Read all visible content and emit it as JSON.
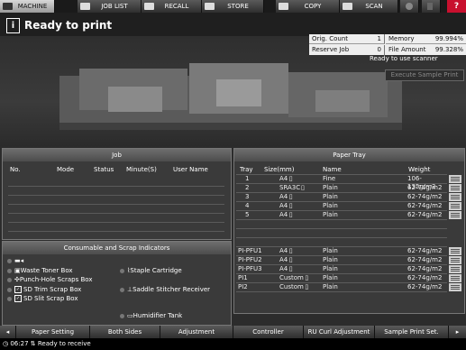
{
  "tabs": [
    {
      "label": "MACHINE",
      "active": true,
      "icon": "machine-icon"
    },
    {
      "label": "JOB LIST",
      "active": false,
      "icon": "job-list-icon"
    },
    {
      "label": "RECALL",
      "active": false,
      "icon": "recall-icon"
    },
    {
      "label": "STORE",
      "active": false,
      "icon": "store-icon"
    },
    {
      "label": "COPY",
      "active": false,
      "icon": "copy-icon"
    },
    {
      "label": "SCAN",
      "active": false,
      "icon": "scan-icon"
    }
  ],
  "help_label": "?",
  "status": {
    "icon": "i",
    "title": "Ready to print"
  },
  "counters": {
    "orig_count_label": "Orig. Count",
    "orig_count_value": "1",
    "memory_label": "Memory",
    "memory_value": "99.994%",
    "reserve_job_label": "Reserve Job",
    "reserve_job_value": "0",
    "file_amount_label": "File Amount",
    "file_amount_value": "99.328%"
  },
  "scanner_msg": "Ready to use scanner",
  "exec_sample_label": "Execute Sample Print",
  "job_panel": {
    "title": "Job",
    "columns": [
      "No.",
      "Mode",
      "Status",
      "Minute(S)",
      "User Name"
    ]
  },
  "tray_panel": {
    "title": "Paper Tray",
    "columns": [
      "Tray",
      "Size(mm)",
      "Name",
      "Weight"
    ],
    "rows": [
      {
        "tray": "1",
        "size": "A4",
        "name": "Fine",
        "weight": "106-135g/m2"
      },
      {
        "tray": "2",
        "size": "SRA3C",
        "name": "Plain",
        "weight": "62-74g/m2"
      },
      {
        "tray": "3",
        "size": "A4",
        "name": "Plain",
        "weight": "62-74g/m2"
      },
      {
        "tray": "4",
        "size": "A4",
        "name": "Plain",
        "weight": "62-74g/m2"
      },
      {
        "tray": "5",
        "size": "A4",
        "name": "Plain",
        "weight": "62-74g/m2"
      },
      {
        "tray": "PI-PFU1",
        "size": "A4",
        "name": "Plain",
        "weight": "62-74g/m2"
      },
      {
        "tray": "PI-PFU2",
        "size": "A4",
        "name": "Plain",
        "weight": "62-74g/m2"
      },
      {
        "tray": "PI-PFU3",
        "size": "A4",
        "name": "Plain",
        "weight": "62-74g/m2"
      },
      {
        "tray": "PI1",
        "size": "Custom",
        "name": "Plain",
        "weight": "62-74g/m2"
      },
      {
        "tray": "PI2",
        "size": "Custom",
        "name": "Plain",
        "weight": "62-74g/m2"
      }
    ]
  },
  "consumables": {
    "title": "Consumable and Scrap Indicators",
    "left": [
      {
        "label": "Waste Toner Box",
        "checked": false
      },
      {
        "label": "Punch-Hole Scraps Box",
        "checked": false
      },
      {
        "label": "SD Trim Scrap Box",
        "checked": true
      },
      {
        "label": "SD Slit Scrap Box",
        "checked": true
      }
    ],
    "right": [
      {
        "label": "Staple Cartridge"
      },
      {
        "label": "Saddle Stitcher Receiver"
      },
      {
        "label": "Humidifier Tank"
      }
    ]
  },
  "bottom_buttons": [
    "Paper Setting",
    "Both Sides",
    "Adjustment",
    "Controller",
    "RU Curl Adjustment",
    "Sample Print Set."
  ],
  "footer": {
    "time": "06:27",
    "message": "Ready to receive"
  }
}
